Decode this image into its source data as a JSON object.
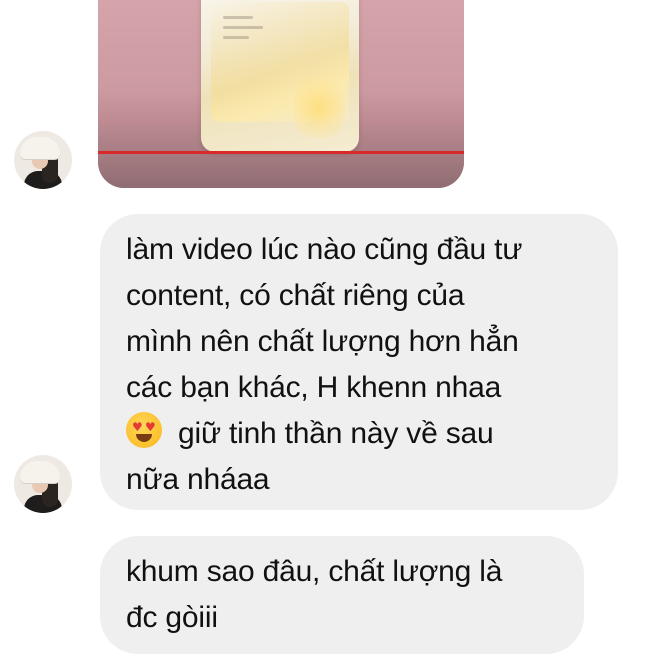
{
  "conversation": {
    "messages": [
      {
        "type": "image",
        "description_icon": "product-image"
      },
      {
        "type": "text",
        "lines": [
          "làm video lúc nào cũng đầu tư",
          "content, có chất riêng của",
          "mình nên chất lượng hơn hẳn",
          "các bạn khác, H khenn nhaa",
          "giữ tinh thần này về sau",
          "nữa nháaa"
        ],
        "emoji": "heart-eyes-emoji"
      },
      {
        "type": "text",
        "lines": [
          "khum sao đâu, chất lượng là",
          "đc gòiii"
        ]
      }
    ]
  },
  "colors": {
    "bubble_background": "#efefef",
    "text": "#111111",
    "progress_line": "#d92a2a"
  }
}
